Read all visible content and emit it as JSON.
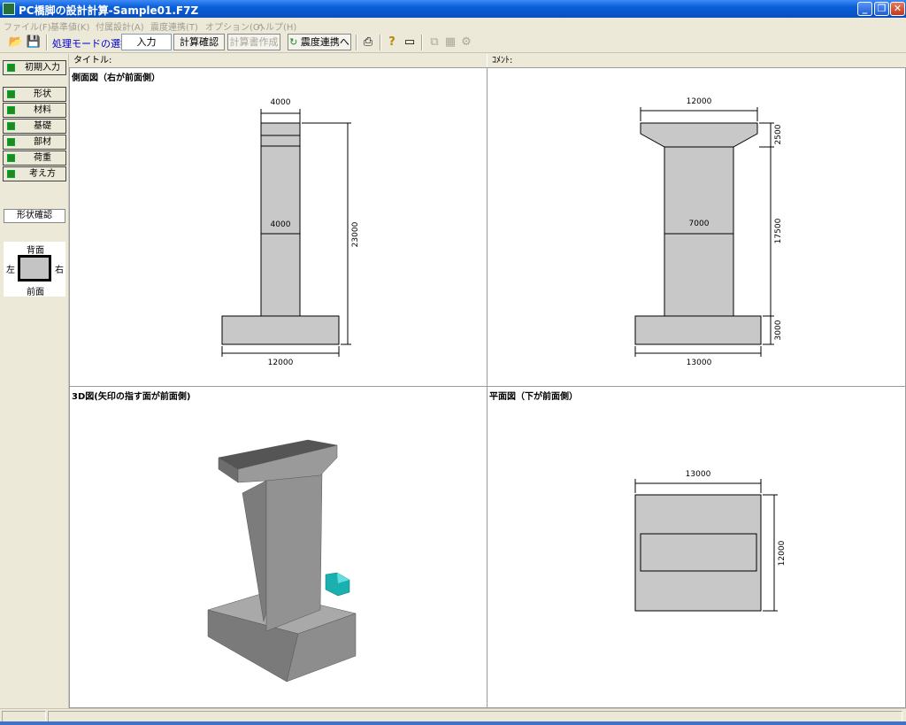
{
  "window": {
    "title": "PC橋脚の設計計算-Sample01.F7Z"
  },
  "menu": [
    "ファイル(F)",
    "基準値(K)",
    "付属設計(A)",
    "震度連携(T)",
    "オプション(O)",
    "ヘルプ(H)"
  ],
  "toolbar": {
    "mode_label": "処理モードの選択",
    "mode_value": "入力",
    "calc_check": "計算確認",
    "report": "計算書作成",
    "seismic": "震度連携へ"
  },
  "left": {
    "initial_input": "初期入力",
    "items": [
      "形状",
      "材料",
      "基礎",
      "部材",
      "荷重",
      "考え方"
    ],
    "shape_confirm": "形状確認",
    "orientation": {
      "back": "背面",
      "front": "前面",
      "left": "左",
      "right": "右"
    }
  },
  "header": {
    "title_label": "タイトル:",
    "comment_label": "ｺﾒﾝﾄ:"
  },
  "panes": {
    "side": {
      "title": "側面図（右が前面側）",
      "dims": {
        "top_width": "4000",
        "mid_width": "4000",
        "bottom_width": "12000",
        "height": "23000"
      }
    },
    "front": {
      "dims": {
        "top_width": "12000",
        "mid_width": "7000",
        "bottom_width": "13000",
        "h_top": "2500",
        "h_mid": "17500",
        "h_bottom": "3000"
      }
    },
    "view3d": {
      "title": "3D図(矢印の指す面が前面側)"
    },
    "plan": {
      "title": "平面図（下が前面側）",
      "dims": {
        "width": "13000",
        "depth": "12000"
      }
    }
  },
  "colors": {
    "concrete": "#c8c8c8",
    "arrow": "#1ab0b0",
    "titlebar": "#0a5fd8"
  }
}
